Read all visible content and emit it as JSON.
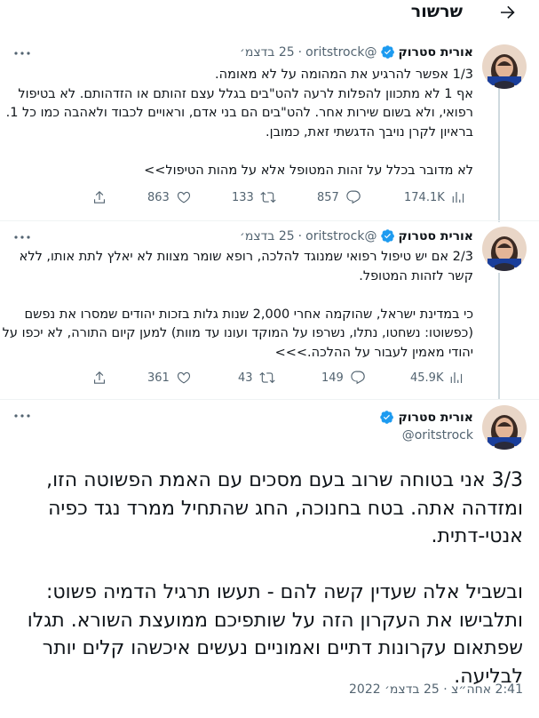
{
  "header": {
    "title": "שרשור"
  },
  "author": {
    "name": "אורית סטרוק",
    "handle": "@oritstrock",
    "avatar_caption": "אורית סטרוק"
  },
  "tweets": [
    {
      "date": "25 בדצמ׳",
      "dot": "·",
      "text": "1/3 אפשר להרגיע את המהומה על לא מאומה.\nאף 1 לא מתכוון להפלות לרעה להט\"בים בגלל עצם זהותם או הזדהותם. לא בטיפול רפואי, ולא בשום שירות אחר. להט\"בים הם בני אדם, וראויים לכבוד ולאהבה כמו כל 1. בראיון לקרן נויבך הדגשתי זאת, כמובן.\n\nלא מדובר בכלל על זהות המטופל אלא על מהות הטיפול>>",
      "replies": "",
      "retweets": "133",
      "likes": "857",
      "views": "174.1K",
      "likes_count": "863"
    },
    {
      "date": "25 בדצמ׳",
      "dot": "·",
      "text": "2/3 אם יש טיפול רפואי שמנוגד להלכה, רופא שומר מצוות לא יאלץ לתת אותו, ללא קשר לזהות המטופל.\n\nכי במדינת ישראל, שהוקמה אחרי 2,000 שנות גלות בזכות יהודים שמסרו את נפשם (כפשוטו: נשחטו, נתלו, נשרפו על המוקד ועונו עד מוות) למען קיום התורה, לא יכפו על יהודי מאמין לעבור על ההלכה.>>>",
      "retweets": "43",
      "likes": "149",
      "views": "45.9K",
      "likes_count": "361"
    }
  ],
  "main_tweet": {
    "text": "3/3 אני בטוחה שרוב בעם מסכים עם האמת הפשוטה הזו, ומזדהה אתה. בטח בחנוכה, החג שהתחיל ממרד נגד כפיה אנטי-דתית.\n\nובשביל אלה שעדין קשה להם - תעשו תרגיל הדמיה פשוט: ותלבישו את העקרון הזה על שותפיכם ממועצת השורא. תגלו שפתאום עקרונות דתיים ואמוניים נעשים איכשהו קלים יותר לבליעה.",
    "timestamp": "2:41 אחה״צ · 25 בדצמ׳ 2022"
  },
  "colors": {
    "text": "#0f1419",
    "muted": "#536471",
    "verified": "#1d9bf0",
    "thread_line": "#cfd9de",
    "avatar_banner": "#1a3e9b"
  },
  "icons": [
    "back-arrow-icon",
    "verified-badge-icon",
    "more-icon",
    "share-icon",
    "like-icon",
    "retweet-icon",
    "reply-icon",
    "views-icon"
  ]
}
